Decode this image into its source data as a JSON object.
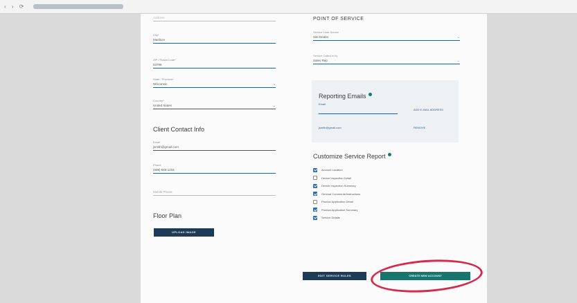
{
  "browser": {
    "nav_icons": "‹ › ⟳",
    "url": ""
  },
  "left_column": {
    "top_field": {
      "label": "",
      "value": "Address"
    },
    "city": {
      "label": "City*",
      "value": "Madison"
    },
    "zip": {
      "label": "ZIP / Postal Code*",
      "value": "53766"
    },
    "state": {
      "label": "State / Province*",
      "value": "Wisconsin"
    },
    "country": {
      "label": "Country*",
      "value": "United States"
    },
    "client_contact_heading": "Client Contact Info",
    "email": {
      "label": "Email",
      "value": "jsmith@gmail.com"
    },
    "phone": {
      "label": "Phone",
      "value": "(608) 555-1234"
    },
    "mobile": {
      "placeholder": "Mobile Phone"
    },
    "floor_plan_heading": "Floor Plan",
    "upload_button": "UPLOAD IMAGE"
  },
  "right_column": {
    "point_of_service_heading": "POINT OF SERVICE",
    "service_lead": {
      "label": "Service Lead Source",
      "value": "Site Dealer"
    },
    "service_call": {
      "label": "Service Called in by",
      "value": "Sales Rep"
    },
    "reporting": {
      "title": "Reporting Emails",
      "email_label": "Email",
      "add_link": "ADD E-MAIL ADDRESS",
      "saved_email": "jsmith@gmail.com",
      "remove_link": "REMOVE"
    },
    "customize_heading": "Customize Service Report",
    "checklist": [
      {
        "label": "Account Location",
        "checked": true
      },
      {
        "label": "Device Inspection Detail",
        "checked": false
      },
      {
        "label": "Device Inspection Summary",
        "checked": true
      },
      {
        "label": "General Comments/Instructions",
        "checked": true
      },
      {
        "label": "Product Application Detail",
        "checked": false
      },
      {
        "label": "Product Application Summary",
        "checked": true
      },
      {
        "label": "Service Details",
        "checked": true
      }
    ],
    "edit_service_rules_button": "EDIT SERVICE RULES",
    "create_account_button": "CREATE NEW ACCOUNT"
  },
  "colors": {
    "accent_blue": "#2d5d8c",
    "navy_button": "#1f3a57",
    "teal_button": "#17756c",
    "highlight_ellipse": "#d62a4c"
  }
}
